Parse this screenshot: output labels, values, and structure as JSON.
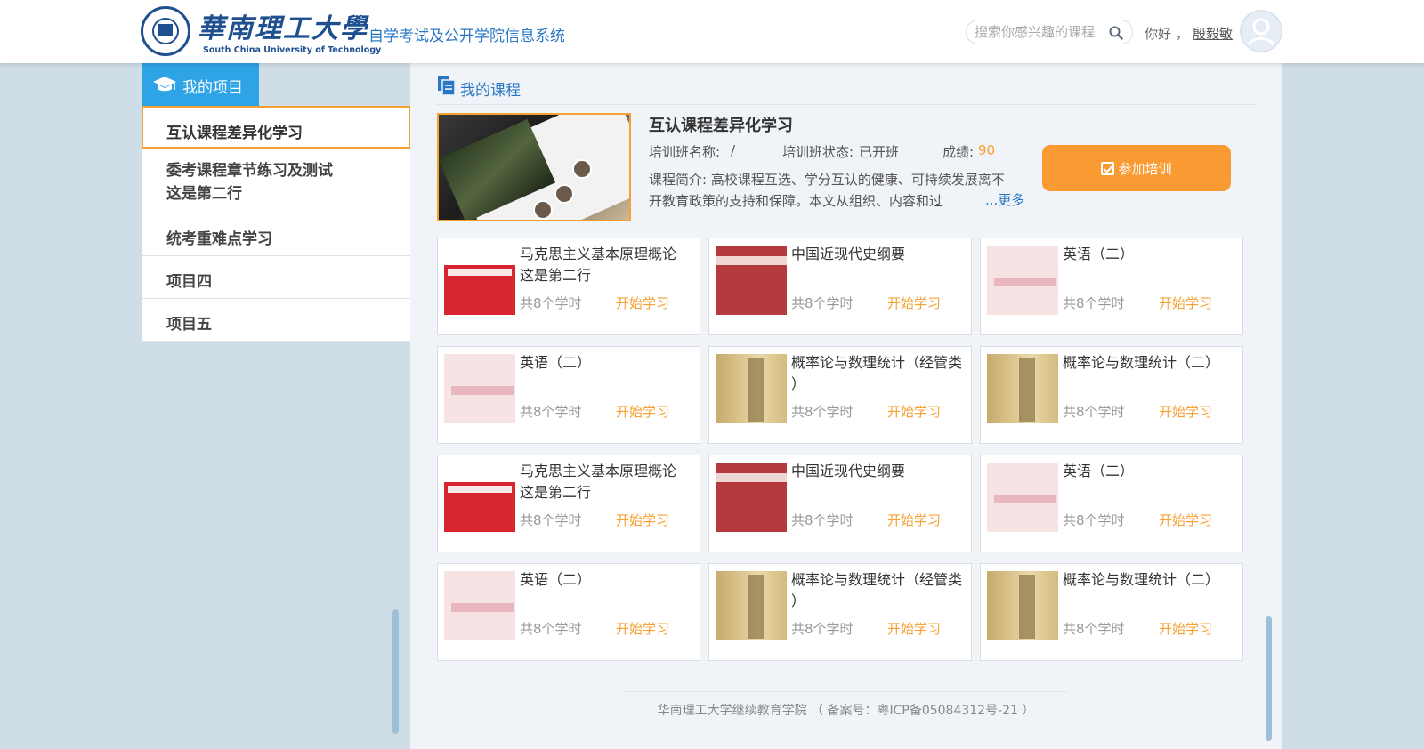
{
  "header": {
    "logo_cn": "華南理工大學",
    "logo_en": "South China University of Technology",
    "system_title": "自学考试及公开学院信息系统",
    "search_placeholder": "搜索你感兴趣的课程",
    "greeting": "你好 ，",
    "username": "殷毅敏"
  },
  "sidebar": {
    "heading": "我的项目",
    "items": [
      {
        "lines": [
          "互认课程差异化学习"
        ],
        "active": true
      },
      {
        "lines": [
          "委考课程章节练习及测试",
          "这是第二行"
        ],
        "active": false
      },
      {
        "lines": [
          "统考重难点学习"
        ],
        "active": false
      },
      {
        "lines": [
          "项目四"
        ],
        "active": false
      },
      {
        "lines": [
          "项目五"
        ],
        "active": false
      }
    ]
  },
  "main": {
    "section_title": "我的课程",
    "featured": {
      "title": "互认课程差异化学习",
      "class_name_label": "培训班名称:",
      "class_name_value": "/",
      "status_label": "培训班状态:",
      "status_value": "已开班",
      "score_label": "成绩:",
      "score_value": "90",
      "desc_label": "课程简介:",
      "description": "高校课程互选、学分互认的健康、可持续发展离不开教育政策的支持和保障。本文从组织、内容和过",
      "more": "...更多",
      "join_label": "参加培训"
    },
    "courses": [
      {
        "name": [
          "马克思主义基本原理概论",
          "这是第二行"
        ],
        "hours": "共8个学时",
        "action": "开始学习",
        "cover": "red"
      },
      {
        "name": [
          "中国近现代史纲要"
        ],
        "hours": "共8个学时",
        "action": "开始学习",
        "cover": "dred"
      },
      {
        "name": [
          "英语（二）"
        ],
        "hours": "共8个学时",
        "action": "开始学习",
        "cover": "pink"
      },
      {
        "name": [
          "英语（二）"
        ],
        "hours": "共8个学时",
        "action": "开始学习",
        "cover": "pink"
      },
      {
        "name": [
          "概率论与数理统计（经管类",
          "）"
        ],
        "hours": "共8个学时",
        "action": "开始学习",
        "cover": "gold"
      },
      {
        "name": [
          "概率论与数理统计（二）"
        ],
        "hours": "共8个学时",
        "action": "开始学习",
        "cover": "gold"
      },
      {
        "name": [
          "马克思主义基本原理概论",
          "这是第二行"
        ],
        "hours": "共8个学时",
        "action": "开始学习",
        "cover": "red"
      },
      {
        "name": [
          "中国近现代史纲要"
        ],
        "hours": "共8个学时",
        "action": "开始学习",
        "cover": "dred"
      },
      {
        "name": [
          "英语（二）"
        ],
        "hours": "共8个学时",
        "action": "开始学习",
        "cover": "pink"
      },
      {
        "name": [
          "英语（二）"
        ],
        "hours": "共8个学时",
        "action": "开始学习",
        "cover": "pink"
      },
      {
        "name": [
          "概率论与数理统计（经管类",
          "）"
        ],
        "hours": "共8个学时",
        "action": "开始学习",
        "cover": "gold"
      },
      {
        "name": [
          "概率论与数理统计（二）"
        ],
        "hours": "共8个学时",
        "action": "开始学习",
        "cover": "gold"
      }
    ],
    "footer": "华南理工大学继续教育学院 （ 备案号：粤ICP备05084312号-21 ）"
  },
  "colors": {
    "accent_blue": "#2a78c5",
    "sidebar_header": "#2ea3e6",
    "orange": "#f7a133"
  },
  "icons": {
    "logo": "university-seal-icon",
    "search": "search-icon",
    "avatar": "user-avatar-icon",
    "sidebar": "graduation-cap-icon",
    "section": "document-icon",
    "join": "checkbox-icon"
  }
}
